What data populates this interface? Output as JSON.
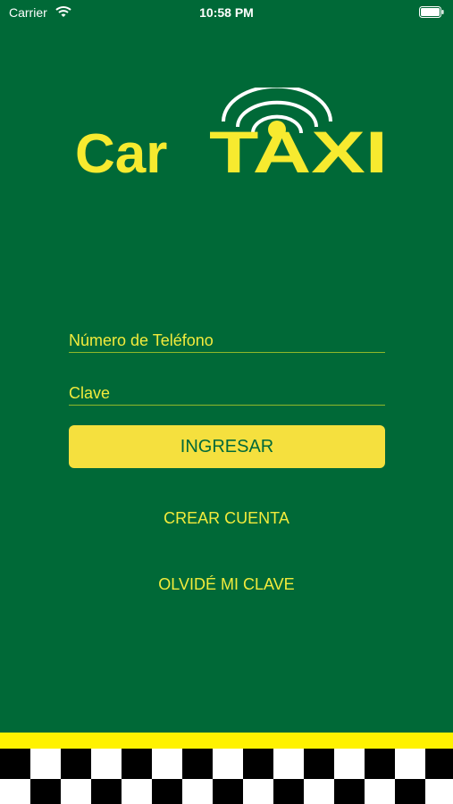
{
  "status_bar": {
    "carrier": "Carrier",
    "time": "10:58 PM"
  },
  "logo": {
    "text_car": "Car",
    "text_taxi": "TAXI",
    "color": "#f7ea2f"
  },
  "form": {
    "phone_placeholder": "Número de Teléfono",
    "password_placeholder": "Clave",
    "login_label": "INGRESAR",
    "create_account_label": "CREAR CUENTA",
    "forgot_password_label": "OLVIDÉ MI CLAVE"
  },
  "colors": {
    "background": "#006937",
    "accent_yellow": "#f5e03e",
    "text_yellow": "#f2eb3c"
  }
}
